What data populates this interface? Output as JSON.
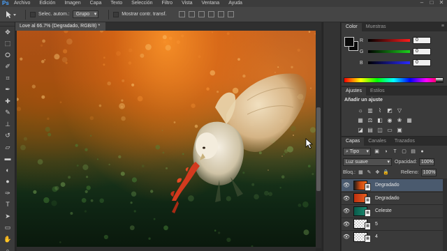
{
  "app": {
    "logo": "Ps"
  },
  "menu": [
    "Archivo",
    "Edición",
    "Imagen",
    "Capa",
    "Texto",
    "Selección",
    "Filtro",
    "Vista",
    "Ventana",
    "Ayuda"
  ],
  "window_controls": [
    "–",
    "□",
    "✕"
  ],
  "options": {
    "auto_select_label": "Selec. autom.:",
    "auto_select_value": "Grupo",
    "show_transform_label": "Mostrar contr. transf."
  },
  "tools": [
    "move-icon",
    "marquee-icon",
    "lasso-icon",
    "quick-select-icon",
    "crop-icon",
    "eyedropper-icon",
    "healing-icon",
    "brush-icon",
    "stamp-icon",
    "history-brush-icon",
    "eraser-icon",
    "gradient-icon",
    "blur-icon",
    "dodge-icon",
    "pen-icon",
    "type-icon",
    "path-select-icon",
    "shape-icon",
    "hand-icon",
    "zoom-icon"
  ],
  "document": {
    "tab_title": "Love al 66.7% (Degradado, RGB/8) *"
  },
  "color_panel": {
    "tabs": [
      "Color",
      "Muestras"
    ],
    "channels": [
      {
        "label": "R",
        "value": "0",
        "gradient": "#ff1c1c"
      },
      {
        "label": "G",
        "value": "0",
        "gradient": "#1cd21c"
      },
      {
        "label": "B",
        "value": "0",
        "gradient": "#2a2aff"
      }
    ]
  },
  "adjust_panel": {
    "tabs": [
      "Ajustes",
      "Estilos"
    ],
    "title": "Añadir un ajuste"
  },
  "layers_panel": {
    "tabs": [
      "Capas",
      "Canales",
      "Trazados"
    ],
    "kind": "Tipo",
    "blend_mode": "Luz suave",
    "opacity_label": "Opacidad:",
    "opacity_value": "100%",
    "lock_label": "Bloq.:",
    "fill_label": "Relleno:",
    "fill_value": "100%",
    "layers": [
      {
        "name": "Degradado",
        "thumb": "linear-gradient(90deg,#1b1b1b,#d04a10,#f07020)",
        "selected": true
      },
      {
        "name": "Degradado",
        "thumb": "linear-gradient(90deg,#c03010,#e86020)",
        "selected": false
      },
      {
        "name": "Celeste",
        "thumb": "linear-gradient(90deg,#0a5a4a,#1a8a70)",
        "selected": false
      },
      {
        "name": "5",
        "thumb": "checker",
        "selected": false
      },
      {
        "name": "4",
        "thumb": "checker",
        "selected": false
      }
    ]
  }
}
